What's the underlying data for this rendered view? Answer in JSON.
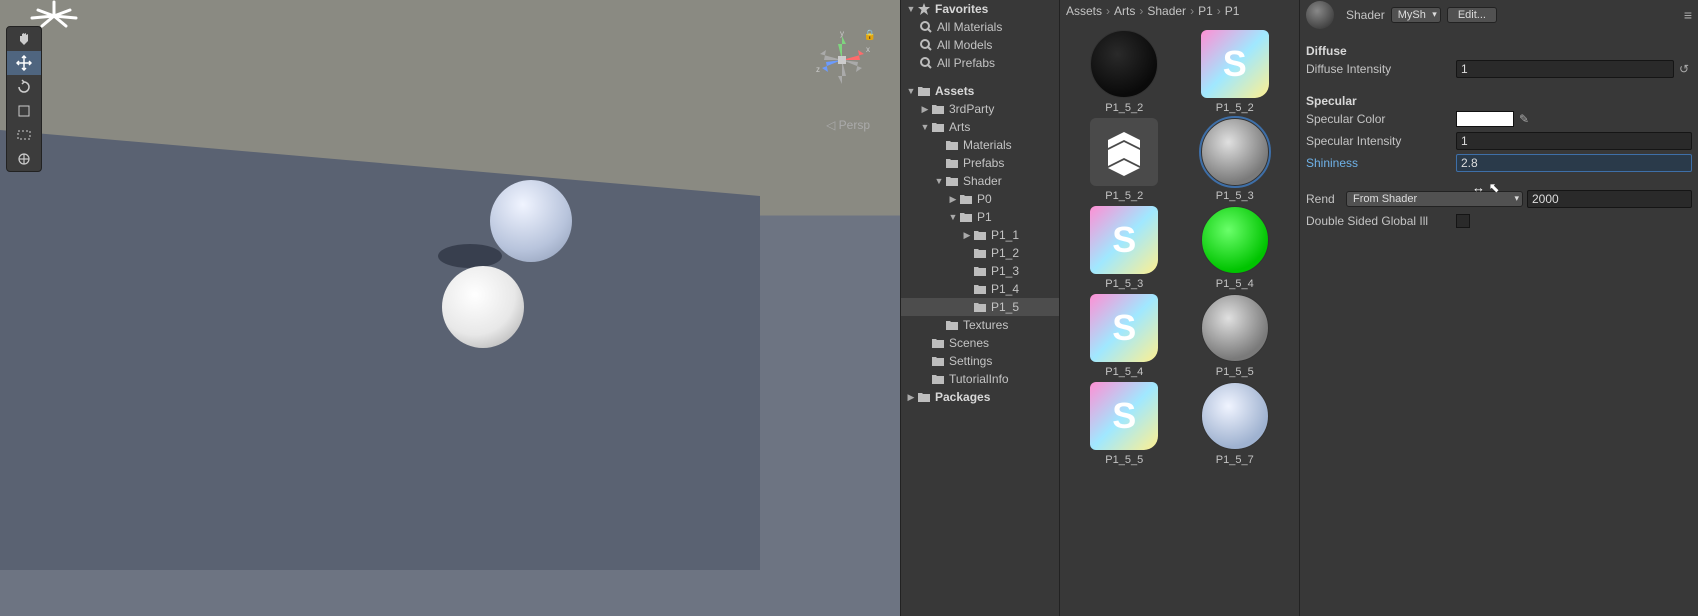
{
  "scene": {
    "persp_label": "Persp"
  },
  "hierarchy": {
    "favorites": {
      "label": "Favorites",
      "items": [
        "All Materials",
        "All Models",
        "All Prefabs"
      ]
    },
    "assets_label": "Assets",
    "tree": {
      "thirdparty": "3rdParty",
      "arts": "Arts",
      "materials": "Materials",
      "prefabs": "Prefabs",
      "shader": "Shader",
      "p0": "P0",
      "p1": "P1",
      "p1_1": "P1_1",
      "p1_2": "P1_2",
      "p1_3": "P1_3",
      "p1_4": "P1_4",
      "p1_5": "P1_5",
      "textures": "Textures",
      "scenes": "Scenes",
      "settings": "Settings",
      "tutorial": "TutorialInfo",
      "packages": "Packages"
    }
  },
  "breadcrumb": [
    "Assets",
    "Arts",
    "Shader",
    "P1",
    "P1"
  ],
  "assets": [
    {
      "label": "P1_5_2",
      "type": "dark-sphere"
    },
    {
      "label": "P1_5_2",
      "type": "shader"
    },
    {
      "label": "P1_5_2",
      "type": "unity"
    },
    {
      "label": "P1_5_3",
      "type": "gray-sphere",
      "selected": true
    },
    {
      "label": "P1_5_3",
      "type": "shader"
    },
    {
      "label": "P1_5_4",
      "type": "green-sphere"
    },
    {
      "label": "P1_5_4",
      "type": "shader"
    },
    {
      "label": "P1_5_5",
      "type": "gray-sphere"
    },
    {
      "label": "P1_5_5",
      "type": "shader"
    },
    {
      "label": "P1_5_7",
      "type": "blue-sphere"
    }
  ],
  "inspector": {
    "shader_label": "Shader",
    "shader_value": "MySh",
    "edit_btn": "Edit...",
    "diffuse_section": "Diffuse",
    "diffuse_intensity_label": "Diffuse Intensity",
    "diffuse_intensity_value": "1",
    "specular_section": "Specular",
    "specular_color_label": "Specular Color",
    "specular_color_value": "#ffffff",
    "specular_intensity_label": "Specular Intensity",
    "specular_intensity_value": "1",
    "shininess_label": "Shininess",
    "shininess_value": "2.8",
    "render_label": "Rend",
    "render_queue_mode": "From Shader",
    "render_queue_value": "2000",
    "double_sided_label": "Double Sided Global Ill"
  }
}
